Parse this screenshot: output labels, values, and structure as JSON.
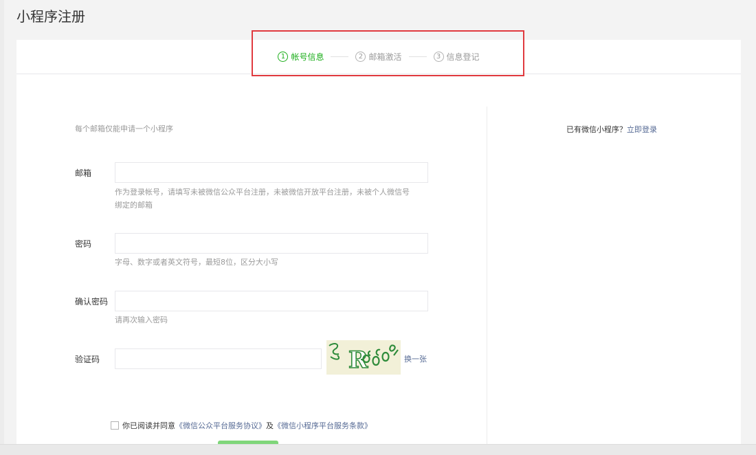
{
  "page": {
    "title": "小程序注册"
  },
  "steps": [
    {
      "num": "1",
      "label": "帐号信息",
      "active": true
    },
    {
      "num": "2",
      "label": "邮箱激活",
      "active": false
    },
    {
      "num": "3",
      "label": "信息登记",
      "active": false
    }
  ],
  "form": {
    "hint": "每个邮箱仅能申请一个小程序",
    "email": {
      "label": "邮箱",
      "value": "",
      "tip_line1": "作为登录帐号，请填写未被微信公众平台注册，未被微信开放平台注册，未被个人微信号",
      "tip_line2": "绑定的邮箱"
    },
    "password": {
      "label": "密码",
      "value": "",
      "tip": "字母、数字或者英文符号，最短8位，区分大小写"
    },
    "confirm": {
      "label": "确认密码",
      "value": "",
      "tip": "请再次输入密码"
    },
    "captcha": {
      "label": "验证码",
      "value": "",
      "image_text": "R",
      "refresh": "换一张"
    },
    "agreement": {
      "prefix": "你已阅读并同意",
      "link1": "《微信公众平台服务协议》",
      "and": "及",
      "link2": "《微信小程序平台服务条款》"
    }
  },
  "side": {
    "question": "已有微信小程序？",
    "login_link": "立即登录"
  },
  "colors": {
    "accent": "#1aad19",
    "link": "#576b95",
    "highlight": "#e0393e"
  }
}
